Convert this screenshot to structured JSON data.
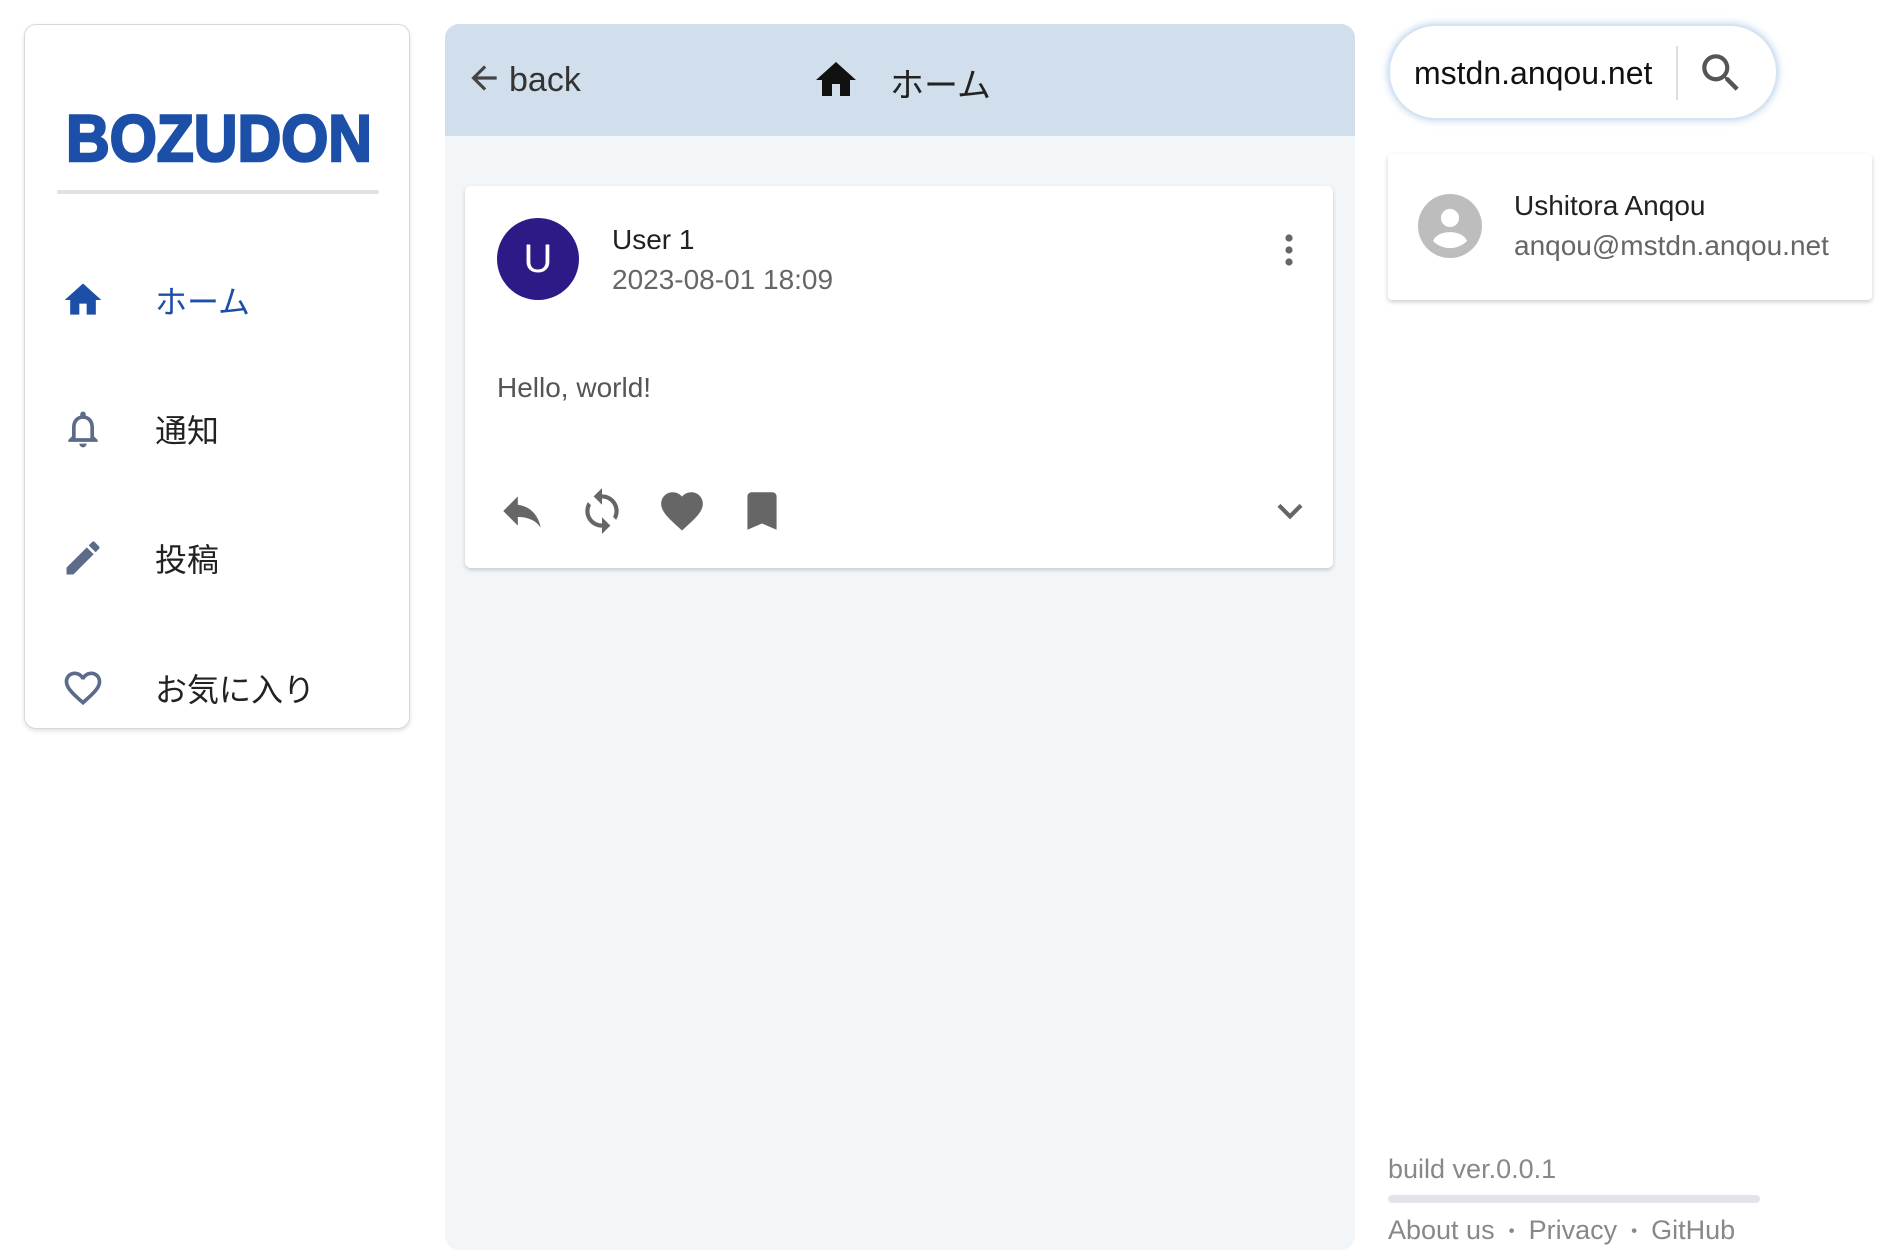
{
  "app": {
    "name": "BOZUDON",
    "brand_color": "#1c4fa8"
  },
  "sidebar": {
    "items": [
      {
        "label": "ホーム",
        "icon": "home-icon",
        "active": true
      },
      {
        "label": "通知",
        "icon": "bell-icon",
        "active": false
      },
      {
        "label": "投稿",
        "icon": "pencil-icon",
        "active": false
      },
      {
        "label": "お気に入り",
        "icon": "heart-outline-icon",
        "active": false
      }
    ]
  },
  "header": {
    "back_label": "back",
    "title": "ホーム"
  },
  "post": {
    "avatar_letter": "U",
    "avatar_color": "#2e1a87",
    "username": "User 1",
    "date": "2023-08-01 18:09",
    "body": "Hello, world!"
  },
  "search": {
    "value": "mstdn.anqou.net"
  },
  "result": {
    "name": "Ushitora Anqou",
    "handle": "anqou@mstdn.anqou.net"
  },
  "footer": {
    "build": "build ver.0.0.1",
    "links": [
      "About us",
      "Privacy",
      "GitHub"
    ],
    "separator": "・"
  }
}
